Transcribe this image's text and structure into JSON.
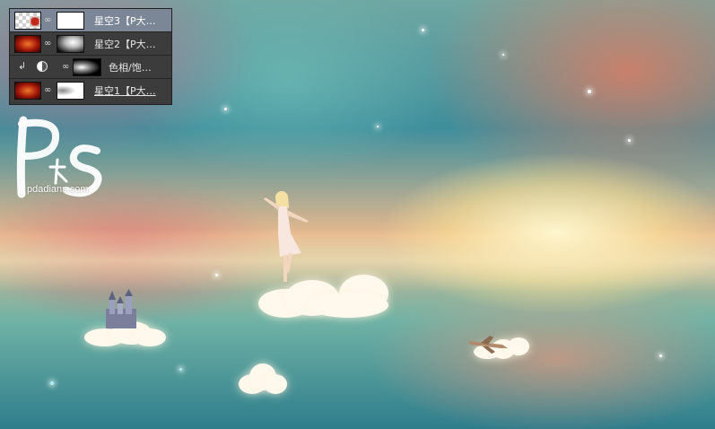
{
  "layers_panel": {
    "layers": [
      {
        "name": "星空3【P大…",
        "selected": true,
        "thumb": "starfield-transparent-thumb",
        "mask": "white-mask"
      },
      {
        "name": "星空2【P大…",
        "selected": false,
        "thumb": "red-nebula-thumb",
        "mask": "gradient-mask"
      },
      {
        "name": "色相/饱…",
        "selected": false,
        "clipped": true,
        "adjustment_icon": "half-circle-icon",
        "mask": "black-white-mask"
      },
      {
        "name": "星空1【P大…",
        "selected": false,
        "thumb": "red-nebula-thumb",
        "mask": "soft-white-mask"
      }
    ]
  },
  "watermark": {
    "logo": "PS",
    "site": "pdadians.com"
  },
  "colors": {
    "panel_bg": "#3c3c3c",
    "selected_row": "#7b8696",
    "text": "#e6e6e6"
  }
}
